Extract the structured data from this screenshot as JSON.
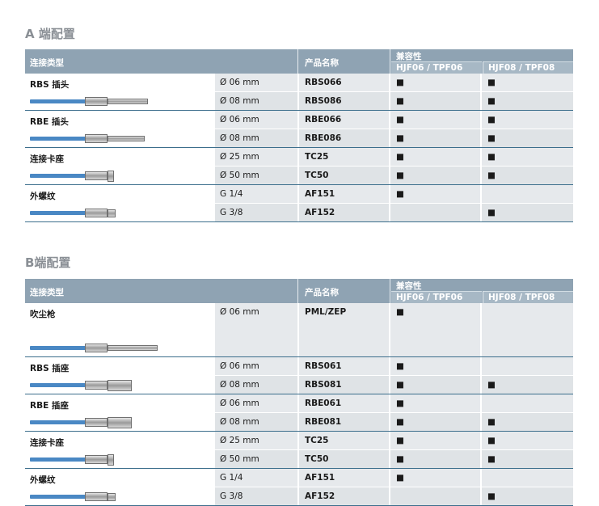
{
  "header": {
    "connection_type": "连接类型",
    "product_name": "产品名称",
    "compatibility": "兼容性",
    "col1": "HJF06 / TPF06",
    "col2": "HJF08 / TPF08"
  },
  "sections": [
    {
      "title": "A 端配置",
      "groups": [
        {
          "label": "RBS 插头",
          "icon": "rbs-plug-icon",
          "rows": [
            {
              "diameter": "Ø 06 mm",
              "product": "RBS066",
              "c1": "■",
              "c2": "■"
            },
            {
              "diameter": "Ø 08 mm",
              "product": "RBS086",
              "c1": "■",
              "c2": "■"
            }
          ]
        },
        {
          "label": "RBE 插头",
          "icon": "rbe-plug-icon",
          "rows": [
            {
              "diameter": "Ø 06 mm",
              "product": "RBE066",
              "c1": "■",
              "c2": "■"
            },
            {
              "diameter": "Ø 08 mm",
              "product": "RBE086",
              "c1": "■",
              "c2": "■"
            }
          ]
        },
        {
          "label": "连接卡座",
          "icon": "clamp-socket-icon",
          "rows": [
            {
              "diameter": "Ø 25 mm",
              "product": "TC25",
              "c1": "■",
              "c2": "■"
            },
            {
              "diameter": "Ø 50 mm",
              "product": "TC50",
              "c1": "■",
              "c2": "■"
            }
          ]
        },
        {
          "label": "外螺纹",
          "icon": "male-thread-icon",
          "rows": [
            {
              "diameter": "G 1/4",
              "product": "AF151",
              "c1": "■",
              "c2": ""
            },
            {
              "diameter": "G 3/8",
              "product": "AF152",
              "c1": "",
              "c2": "■"
            }
          ]
        }
      ]
    },
    {
      "title": "B端配置",
      "groups": [
        {
          "label": "吹尘枪",
          "icon": "blow-gun-icon",
          "rows": [
            {
              "diameter": "Ø 06 mm",
              "product": "PML/ZEP",
              "c1": "■",
              "c2": ""
            }
          ]
        },
        {
          "label": "RBS 插座",
          "icon": "rbs-socket-icon",
          "rows": [
            {
              "diameter": "Ø 06 mm",
              "product": "RBS061",
              "c1": "■",
              "c2": ""
            },
            {
              "diameter": "Ø 08 mm",
              "product": "RBS081",
              "c1": "■",
              "c2": "■"
            }
          ]
        },
        {
          "label": "RBE 插座",
          "icon": "rbe-socket-icon",
          "rows": [
            {
              "diameter": "Ø 06 mm",
              "product": "RBE061",
              "c1": "■",
              "c2": ""
            },
            {
              "diameter": "Ø 08 mm",
              "product": "RBE081",
              "c1": "■",
              "c2": "■"
            }
          ]
        },
        {
          "label": "连接卡座",
          "icon": "clamp-socket-icon",
          "rows": [
            {
              "diameter": "Ø 25 mm",
              "product": "TC25",
              "c1": "■",
              "c2": "■"
            },
            {
              "diameter": "Ø 50 mm",
              "product": "TC50",
              "c1": "■",
              "c2": "■"
            }
          ]
        },
        {
          "label": "外螺纹",
          "icon": "male-thread-icon",
          "rows": [
            {
              "diameter": "G 1/4",
              "product": "AF151",
              "c1": "■",
              "c2": ""
            },
            {
              "diameter": "G 3/8",
              "product": "AF152",
              "c1": "",
              "c2": "■"
            }
          ]
        }
      ]
    }
  ]
}
